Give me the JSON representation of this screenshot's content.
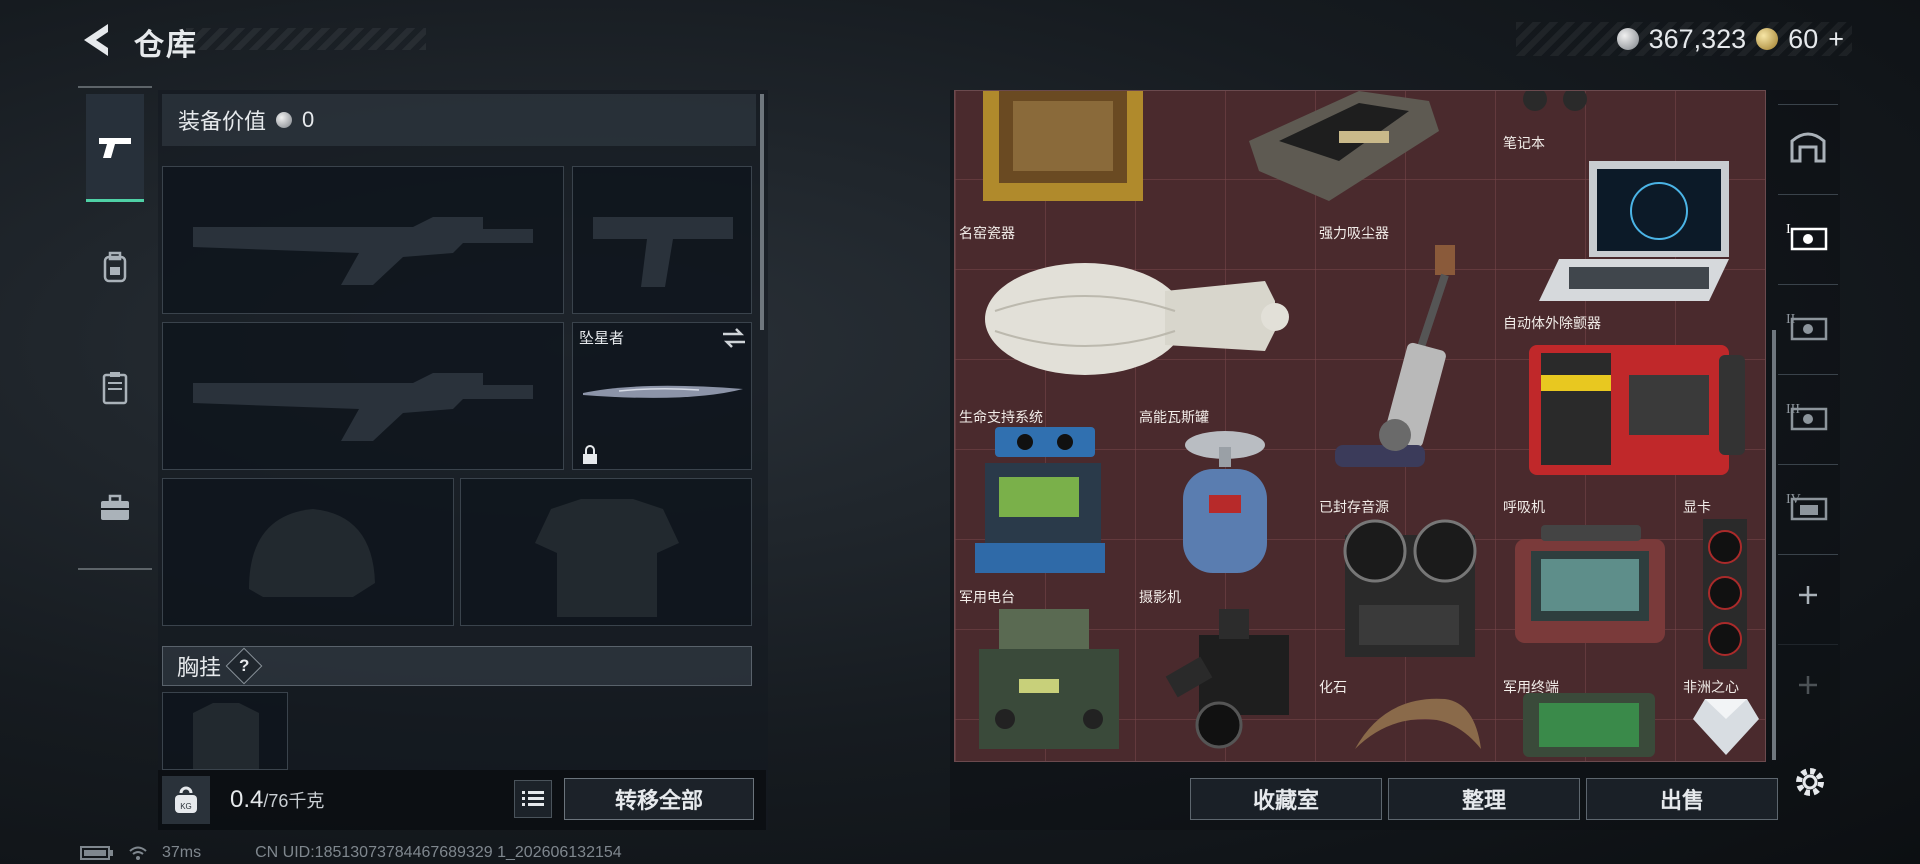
{
  "header": {
    "title": "仓库",
    "currency_silver": "367,323",
    "currency_gold": "60",
    "gold_plus": "+"
  },
  "nav": {
    "items": [
      "weapon",
      "backpack",
      "armor-vest",
      "case"
    ]
  },
  "equipment": {
    "value_label": "装备价值",
    "value": "0",
    "melee_slot_name": "坠星者",
    "chest_rig_label": "胸挂",
    "help_mark": "?"
  },
  "capacity": {
    "current": "0.4",
    "max": "/76",
    "unit": "千克"
  },
  "buttons": {
    "transfer_all": "转移全部",
    "collection": "收藏室",
    "organize": "整理",
    "sell": "出售"
  },
  "status": {
    "ping": "37ms",
    "uid": "CN UID:18513073784467689329 1_202606132154"
  },
  "storage_items": [
    {
      "name": "笔记本"
    },
    {
      "name": "名窑瓷器"
    },
    {
      "name": "强力吸尘器"
    },
    {
      "name": "自动体外除颤器"
    },
    {
      "name": "生命支持系统"
    },
    {
      "name": "高能瓦斯罐"
    },
    {
      "name": "已封存音源"
    },
    {
      "name": "呼吸机"
    },
    {
      "name": "显卡"
    },
    {
      "name": "军用电台"
    },
    {
      "name": "摄影机"
    },
    {
      "name": "化石"
    },
    {
      "name": "军用终端"
    },
    {
      "name": "非洲之心"
    }
  ],
  "colors": {
    "accent": "#4fd1a6",
    "grid_bg": "#4a2a2d",
    "panel": "#141a21"
  }
}
